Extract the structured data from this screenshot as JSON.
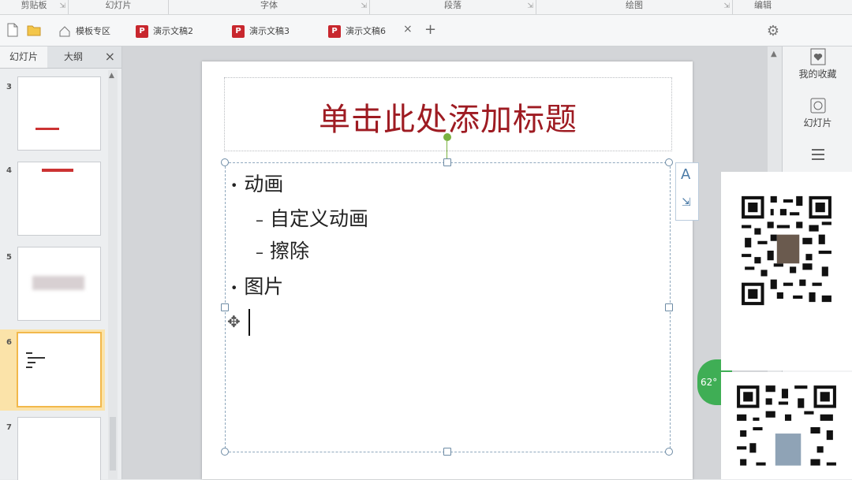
{
  "ribbon": {
    "groups": [
      {
        "label": "剪贴板"
      },
      {
        "label": "幻灯片"
      },
      {
        "label": "字体"
      },
      {
        "label": "段落"
      },
      {
        "label": "绘图"
      },
      {
        "label": "编辑"
      }
    ]
  },
  "tabbar": {
    "tabs": [
      {
        "label": "模板专区"
      },
      {
        "label": "演示文稿2"
      },
      {
        "label": "演示文稿3"
      },
      {
        "label": "演示文稿6"
      }
    ],
    "close_glyph": "×",
    "add_glyph": "+"
  },
  "left_panel": {
    "tab_slides": "幻灯片",
    "tab_outline": "大纲",
    "close_glyph": "×",
    "thumbs": [
      {
        "num": "3"
      },
      {
        "num": "4"
      },
      {
        "num": "5"
      },
      {
        "num": "6"
      },
      {
        "num": "7"
      }
    ]
  },
  "slide": {
    "title": "单击此处添加标题",
    "bullets": [
      {
        "level": 1,
        "text": "动画"
      },
      {
        "level": 2,
        "text": "自定义动画"
      },
      {
        "level": 2,
        "text": "擦除"
      },
      {
        "level": 1,
        "text": "图片"
      }
    ],
    "side_tool_text": "A"
  },
  "right_bar": {
    "items": [
      {
        "label": "我的收藏",
        "icon": "heart-box-icon"
      },
      {
        "label": "幻灯片",
        "icon": "slides-icon"
      }
    ]
  },
  "overlay": {
    "badge_text": "62°",
    "badge_color": "#3fae55"
  },
  "colors": {
    "title": "#9e1b22",
    "selection": "#f2b84b",
    "doc_icon": "#c8272e"
  }
}
